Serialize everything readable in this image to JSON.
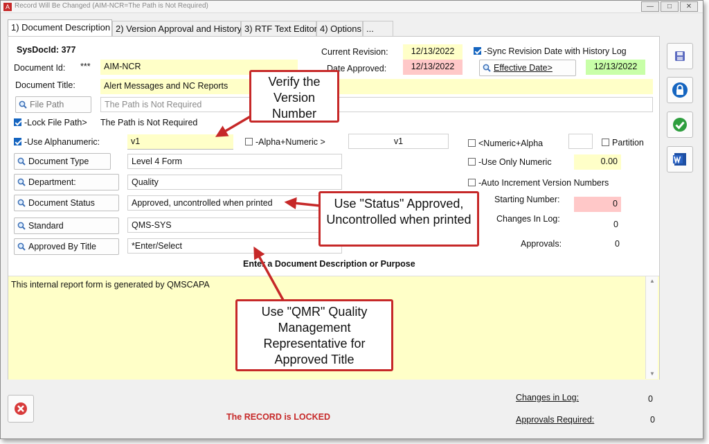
{
  "window": {
    "title": "Record Will Be Changed  (AIM-NCR=The Path is Not Required)"
  },
  "tabs": [
    {
      "label": "1) Document Description"
    },
    {
      "label": "2) Version Approval and History"
    },
    {
      "label": "3) RTF Text Editor"
    },
    {
      "label": "4) Options"
    },
    {
      "label": "..."
    }
  ],
  "form": {
    "sysdocid": "SysDocId: 377",
    "document_id_label": "Document Id:",
    "document_id_stars": "***",
    "document_id": "AIM-NCR",
    "document_title_label": "Document Title:",
    "document_title": "Alert Messages and NC Reports",
    "file_path_label": "File Path",
    "file_path_placeholder": "The Path is Not Required",
    "lock_file_path_label": "-Lock File Path>",
    "lock_file_path_value": "The Path is Not Required",
    "current_revision_label": "Current Revision:",
    "current_revision": "12/13/2022",
    "date_approved_label": "Date Approved:",
    "date_approved": "12/13/2022",
    "sync_label": "-Sync Revision Date with History Log",
    "effective_date_label": "Effective Date>",
    "effective_date": "12/13/2022",
    "use_alphanumeric_label": "-Use Alphanumeric:",
    "version": "v1",
    "alpha_numeric_label": "-Alpha+Numeric >",
    "alpha_numeric_value": "v1",
    "numeric_alpha_label": "<Numeric+Alpha",
    "partition_label": "Partition",
    "use_only_numeric_label": "-Use Only Numeric",
    "numeric_value": "0.00",
    "auto_increment_label": "-Auto Increment Version Numbers",
    "starting_number_label": "Starting Number:",
    "starting_number": "0",
    "changes_in_log_label": "Changes In Log:",
    "changes_in_log": "0",
    "approvals_label": "Approvals:",
    "approvals": "0",
    "document_type_label": "Document Type",
    "document_type": "Level 4 Form",
    "department_label": "Department:",
    "department": "Quality",
    "document_status_label": "Document Status",
    "document_status": "Approved, uncontrolled when printed",
    "standard_label": "Standard",
    "standard": "QMS-SYS",
    "approved_by_title_label": "Approved By Title",
    "approved_by_title": "*Enter/Select",
    "description_heading": "Enter a Document Description or Purpose",
    "description": "This internal report form is generated by QMSCAPA"
  },
  "footer": {
    "locked_text": "The RECORD is LOCKED",
    "changes_in_log_label": "Changes in Log:",
    "changes_in_log": "0",
    "approvals_required_label": "Approvals Required:",
    "approvals_required": "0"
  },
  "callouts": {
    "verify": "Verify the Version Number",
    "status": "Use \"Status\" Approved, Uncontrolled when printed",
    "qmr": "Use \"QMR\" Quality Management Representative for Approved Title"
  },
  "colors": {
    "callout_border": "#c62828",
    "field_yellow": "#ffffc8",
    "field_pink": "#ffc8c8",
    "field_green": "#c8ffa8",
    "locked_text": "#c62828"
  },
  "icons": [
    "save-icon",
    "lock-icon",
    "checkmark-icon",
    "word-icon",
    "cancel-icon",
    "magnifier-icon"
  ]
}
